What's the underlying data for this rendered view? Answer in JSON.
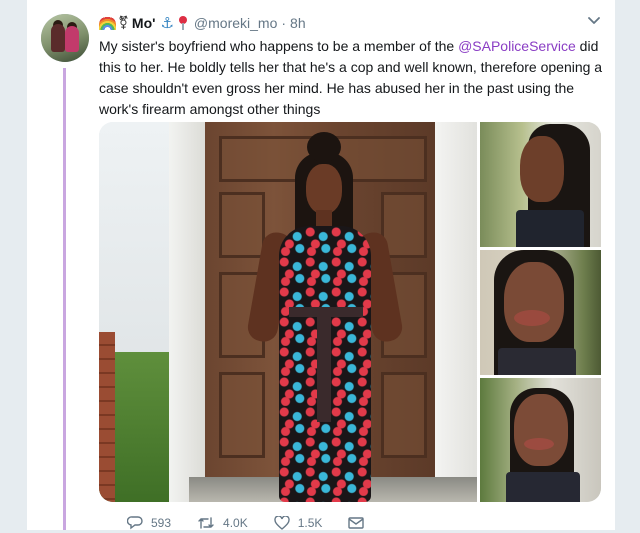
{
  "tweet": {
    "display_name": "Mo'",
    "handle": "@moreki_mo",
    "separator": "·",
    "time": "8h",
    "text_part1": "My sister's boyfriend who happens to be a member of the ",
    "mention": "@SAPoliceService",
    "text_part2": " did this to her. He boldly tells her that he's a cop and well known, therefore opening a case shouldn't even gross her mind. He has abused her in the past using the work's firearm amongst other things"
  },
  "actions": {
    "reply_count": "593",
    "retweet_count": "4.0K",
    "like_count": "1.5K"
  },
  "icons": {
    "rainbow": "rainbow-emoji",
    "gender": "transgender-symbol-emoji",
    "anchor": "anchor-emoji",
    "pin": "round-pushpin-emoji",
    "menu": "chevron-down-icon",
    "reply": "reply-icon",
    "retweet": "retweet-icon",
    "like": "heart-icon",
    "message": "direct-message-icon"
  },
  "glyphs": {
    "gender": "⚧",
    "anchor": "⚓"
  },
  "colors": {
    "link": "#8a3dc4",
    "thread_line": "#c9a6e0",
    "meta": "#657786"
  }
}
